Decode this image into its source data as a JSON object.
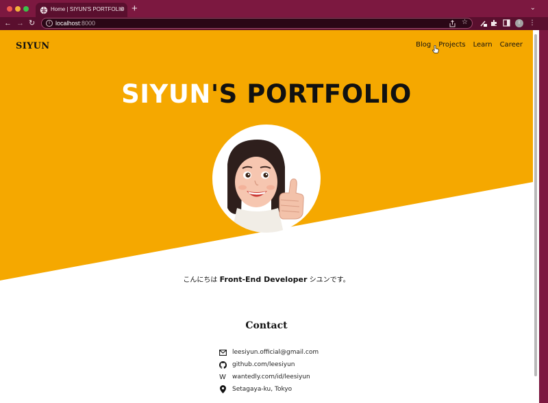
{
  "browser": {
    "tab_title": "Home | SIYUN'S PORTFOLIO",
    "tab_close": "×",
    "new_tab": "+",
    "tab_menu": "⌄",
    "url_host": "localhost",
    "url_port": ":8000",
    "back": "←",
    "forward": "→",
    "reload": "↻",
    "info_icon": "i",
    "star_icon": "☆",
    "menu_icon": "⋮",
    "avatar_initial": "I"
  },
  "site": {
    "logo": "SIYUN",
    "nav": [
      {
        "label": "Blog"
      },
      {
        "label": "Projects"
      },
      {
        "label": "Learn"
      },
      {
        "label": "Career"
      }
    ],
    "hero": {
      "title_name": "SIYUN",
      "title_rest": "'S PORTFOLIO"
    },
    "greeting": {
      "prefix": "こんにちは ",
      "role": "Front-End Developer",
      "suffix": " シユンです。"
    },
    "contact": {
      "title": "Contact",
      "items": [
        {
          "icon": "mail-icon",
          "glyph": "✉",
          "text": "leesiyun.official@gmail.com"
        },
        {
          "icon": "github-icon",
          "glyph": "",
          "text": "github.com/leesiyun"
        },
        {
          "icon": "wantedly-icon",
          "glyph": "W",
          "text": "wantedly.com/id/leesiyun"
        },
        {
          "icon": "location-pin-icon",
          "glyph": "",
          "text": "Setagaya-ku, Tokyo"
        }
      ]
    }
  },
  "colors": {
    "hero_yellow": "#f5a800",
    "browser_frame": "#7c1840"
  }
}
